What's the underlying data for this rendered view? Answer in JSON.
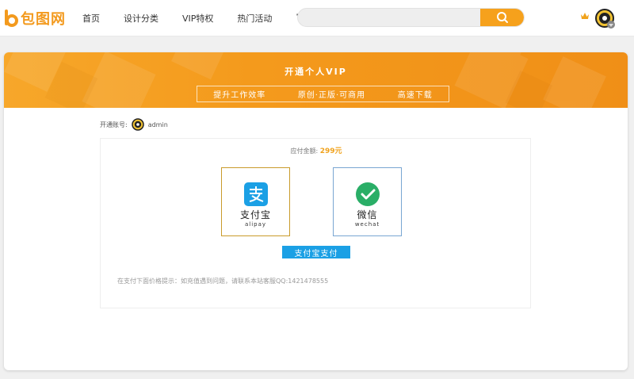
{
  "header": {
    "logo_text": "包图网",
    "nav": [
      {
        "label": "首页"
      },
      {
        "label": "设计分类"
      },
      {
        "label": "VIP特权"
      },
      {
        "label": "热门活动"
      }
    ],
    "more_label": "···",
    "search": {
      "value": "",
      "placeholder": ""
    }
  },
  "banner": {
    "title": "开通个人VIP",
    "benefits": [
      "提升工作效率",
      "原创·正版·可商用",
      "高速下载"
    ]
  },
  "account": {
    "label": "开通账号:",
    "username": "admin"
  },
  "payment": {
    "amount_label": "应付金额:",
    "amount_value": "299元",
    "methods": [
      {
        "cn": "支付宝",
        "en": "alipay"
      },
      {
        "cn": "微信",
        "en": "wechat"
      }
    ],
    "pay_button_label": "支付宝支付",
    "notice": "在支付下面价格提示：如充值遇到问题，请联系本站客服QQ:1421478555"
  },
  "colors": {
    "brand_orange": "#f49a1c",
    "alipay_blue": "#1ba0e5",
    "wechat_green": "#2aae67"
  },
  "icons": {
    "search": "search-icon",
    "crown": "crown-icon",
    "alipay": "alipay-logo-icon",
    "wechat": "wechat-logo-icon"
  }
}
